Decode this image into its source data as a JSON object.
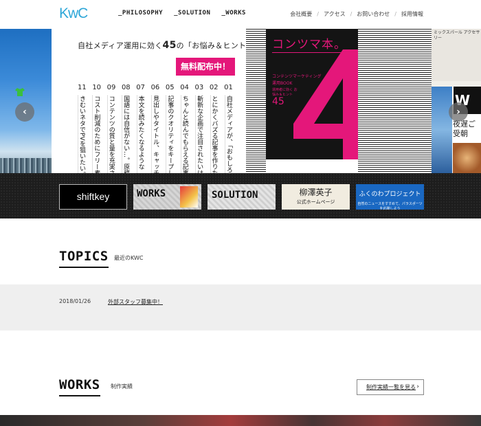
{
  "header": {
    "logo": "KwC",
    "main_nav": [
      "_PHILOSOPHY",
      "_SOLUTION",
      "_WORKS"
    ],
    "sub_nav": [
      "会社概要",
      "アクセス",
      "お問い合わせ",
      "採用情報"
    ],
    "separator": "/"
  },
  "hero": {
    "title_prefix": "自社メディア運用に効く",
    "title_number": "45",
    "title_suffix": "の「お悩み＆ヒント」",
    "badge": "無料配布中！",
    "columns": [
      {
        "num": "11",
        "text": "きむいネタでPVを狙いたい。ど"
      },
      {
        "num": "10",
        "text": "コスト削減のためにフリー素材を活"
      },
      {
        "num": "09",
        "text": "コンテンツの質と量を充実させたい"
      },
      {
        "num": "08",
        "text": "国語には自信がない…。原稿チェ"
      },
      {
        "num": "07",
        "text": "本文を読みたくなるような「リード文"
      },
      {
        "num": "06",
        "text": "見出しやタイトル、キャッチで負け"
      },
      {
        "num": "05",
        "text": "記事のクオリティをキープし続ける"
      },
      {
        "num": "04",
        "text": "ちゃんと読んでもらえる記事の長さ"
      },
      {
        "num": "03",
        "text": "斬新な企画で注目されたいけど、コ"
      },
      {
        "num": "02",
        "text": "とにかくバズる記事を作りたい！"
      },
      {
        "num": "01",
        "text": "自社メディアが、「おもしろくない」"
      }
    ],
    "book": {
      "title": "コンツマ本。",
      "sub1": "コンテンツマーケティング",
      "sub2": "運用BOOK",
      "sub3": "運用者に効く お悩み＆ヒント",
      "number": "45"
    },
    "right_slide": {
      "accessory_title": "ミックスパール アクセサリー",
      "mag_letter": "W",
      "mag_title": "夜遅ご 受朝"
    },
    "prev_arrow": "‹",
    "next_arrow": "›"
  },
  "banners": {
    "shiftkey": "shiftkey",
    "works": "WORKS",
    "solution": "SOLUTION",
    "yanagisawa_name": "柳澤英子",
    "yanagisawa_sub": "公式ホームページ",
    "fukunowa_name": "ふくのわプロジェクト",
    "fukunowa_sub": "自然のニュースをすすめて、パラスポーツを応援しよう"
  },
  "topics": {
    "title": "TOPICS",
    "subtitle": "最近のKWC",
    "items": [
      {
        "date": "2018/01/26",
        "text": "外部スタッフ募集中！"
      }
    ]
  },
  "works": {
    "title": "WORKS",
    "subtitle": "制作実績",
    "button": "制作実績一覧を見る",
    "button_chevron": "›"
  },
  "colors": {
    "brand_blue": "#2fa7d8",
    "accent_pink": "#e4177a",
    "dark_strip": "#1d1d1d",
    "topics_band": "#efefef"
  }
}
